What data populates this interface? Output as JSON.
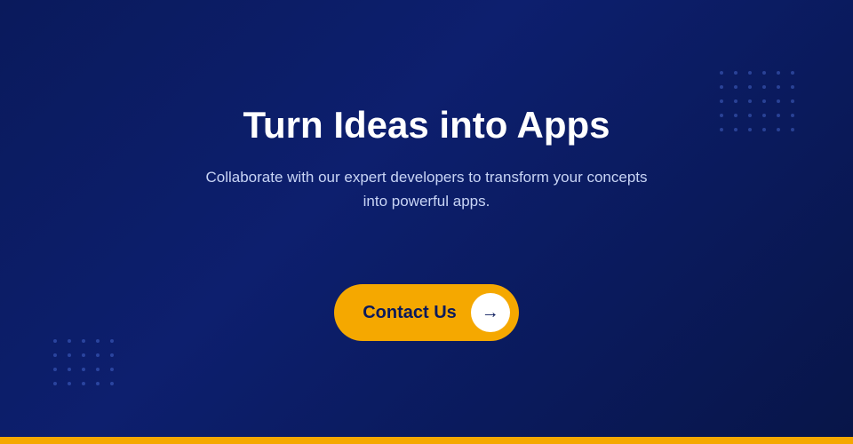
{
  "page": {
    "background_start": "#0a1a5c",
    "background_end": "#081548",
    "gold_bar_color": "#f5a800"
  },
  "hero": {
    "title": "Turn Ideas into Apps",
    "subtitle": "Collaborate with our expert developers to transform your concepts into powerful apps.",
    "cta_button_label": "Contact Us",
    "cta_arrow": "→"
  }
}
